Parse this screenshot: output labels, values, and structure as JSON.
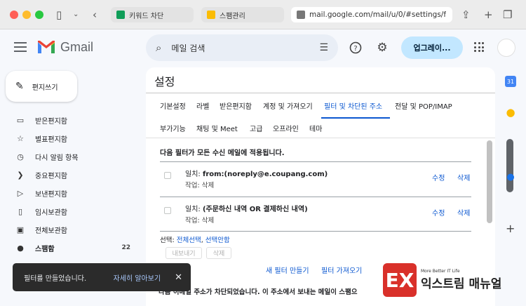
{
  "browser": {
    "tabs": [
      {
        "title": "키워드 차단",
        "favicon_color": "#0f9d58"
      },
      {
        "title": "스팸관리",
        "favicon_color": "#fbbc04"
      }
    ],
    "url": "mail.google.com/mail/u/0/#settings/f"
  },
  "header": {
    "logo_text": "Gmail",
    "search_placeholder": "메일 검색",
    "upgrade_label": "업그레이..."
  },
  "sidebar": {
    "compose_label": "편지쓰기",
    "items": [
      {
        "label": "받은편지함",
        "icon": "inbox-icon",
        "glyph": "▭"
      },
      {
        "label": "별표편지함",
        "icon": "star-icon",
        "glyph": "☆"
      },
      {
        "label": "다시 알림 항목",
        "icon": "clock-icon",
        "glyph": "◷"
      },
      {
        "label": "중요편지함",
        "icon": "label-important-icon",
        "glyph": "❯"
      },
      {
        "label": "보낸편지함",
        "icon": "send-icon",
        "glyph": "▷"
      },
      {
        "label": "임시보관함",
        "icon": "draft-icon",
        "glyph": "▯"
      },
      {
        "label": "전체보관함",
        "icon": "all-mail-icon",
        "glyph": "▣"
      },
      {
        "label": "스팸함",
        "icon": "spam-icon",
        "glyph": "●",
        "count": "22"
      }
    ]
  },
  "settings": {
    "title": "설정",
    "tabs_row1": [
      "기본설정",
      "라벨",
      "받은편지함",
      "계정 및 가져오기",
      "필터 및 차단된 주소",
      "전달 및 POP/IMAP"
    ],
    "tabs_row2": [
      "부가기능",
      "채팅 및 Meet",
      "고급",
      "오프라인",
      "테마"
    ],
    "active_tab": "필터 및 차단된 주소",
    "filter_intro": "다음 필터가 모든 수신 메일에 적용됩니다.",
    "filters": [
      {
        "match_label": "일치:",
        "match_value": "from:(noreply@e.coupang.com)",
        "action": "작업: 삭제"
      },
      {
        "match_label": "일치:",
        "match_value": "(주문하신 내역 OR 결제하신 내역)",
        "action": "작업: 삭제"
      }
    ],
    "edit_label": "수정",
    "delete_label": "삭제",
    "select_prefix": "선택:",
    "select_all": "전체선택",
    "select_none": "선택안함",
    "select_separator": ",",
    "export_label": "내보내기",
    "delete_btn_label": "삭제",
    "new_filter_label": "새 필터 만들기",
    "import_filter_label": "필터 가져오기",
    "blocked_text": "다음 이메일 주소가 차단되었습니다. 이 주소에서 보내는 메일이 스팸으"
  },
  "toast": {
    "message": "필터를 만들었습니다.",
    "link": "자세히 알아보기"
  },
  "watermark": {
    "logo_letters": "EX",
    "small": "More Better IT Life",
    "big": "익스트림 매뉴얼"
  },
  "right_panel": {
    "calendar_day": "31"
  },
  "colors": {
    "accent_blue": "#0b57d0",
    "upgrade_bg": "#c2e7ff",
    "toast_bg": "#2b2b2b"
  }
}
